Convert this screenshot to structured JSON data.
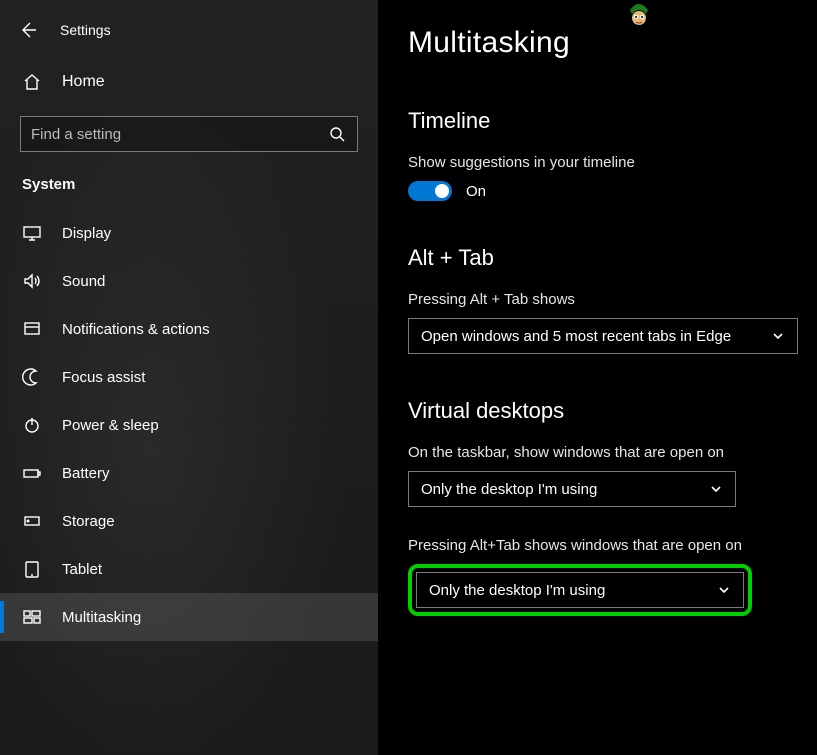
{
  "window": {
    "title": "Settings"
  },
  "home": {
    "label": "Home"
  },
  "search": {
    "placeholder": "Find a setting"
  },
  "category": {
    "label": "System"
  },
  "nav": [
    {
      "id": "display",
      "label": "Display"
    },
    {
      "id": "sound",
      "label": "Sound"
    },
    {
      "id": "notifications",
      "label": "Notifications & actions"
    },
    {
      "id": "focus",
      "label": "Focus assist"
    },
    {
      "id": "power",
      "label": "Power & sleep"
    },
    {
      "id": "battery",
      "label": "Battery"
    },
    {
      "id": "storage",
      "label": "Storage"
    },
    {
      "id": "tablet",
      "label": "Tablet"
    },
    {
      "id": "multitasking",
      "label": "Multitasking"
    }
  ],
  "page": {
    "title": "Multitasking"
  },
  "timeline": {
    "heading": "Timeline",
    "option_label": "Show suggestions in your timeline",
    "toggle_state": "On"
  },
  "alt_tab": {
    "heading": "Alt + Tab",
    "option_label": "Pressing Alt + Tab shows",
    "value": "Open windows and 5 most recent tabs in Edge"
  },
  "virtual_desktops": {
    "heading": "Virtual desktops",
    "taskbar_label": "On the taskbar, show windows that are open on",
    "taskbar_value": "Only the desktop I'm using",
    "alttab_label": "Pressing Alt+Tab shows windows that are open on",
    "alttab_value": "Only the desktop I'm using"
  }
}
